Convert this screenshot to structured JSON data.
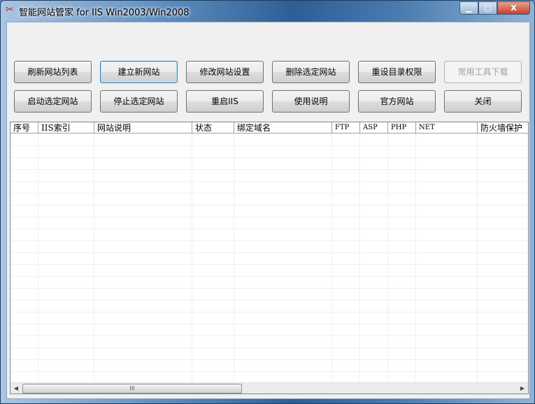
{
  "window": {
    "title": "智能网站管家 for IIS Win2003/Win2008",
    "min": "▁",
    "max": "▢",
    "close": "X"
  },
  "buttons_row1": [
    "刷新网站列表",
    "建立新网站",
    "修改网站设置",
    "删除选定网站",
    "重设目录权限",
    "常用工具下载"
  ],
  "buttons_row2": [
    "启动选定网站",
    "停止选定网站",
    "重启IIS",
    "使用说明",
    "官方网站",
    "关闭"
  ],
  "table": {
    "columns": [
      "序号",
      "IIS索引",
      "网站说明",
      "状态",
      "绑定域名",
      "FTP",
      "ASP",
      "PHP",
      "NET",
      "防火墙保护"
    ],
    "rows": []
  },
  "scrollbar": {
    "grip": "III",
    "left": "◀",
    "right": "▶"
  }
}
